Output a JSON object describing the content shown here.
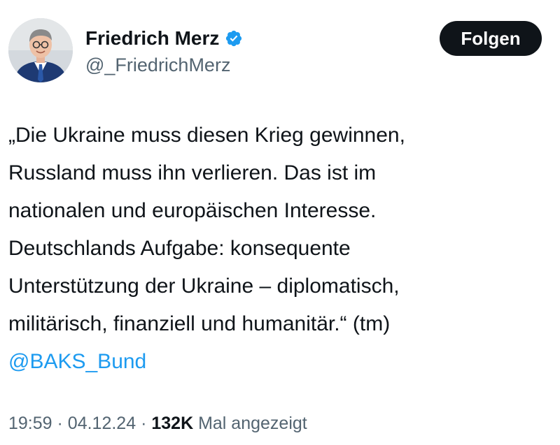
{
  "author": {
    "display_name": "Friedrich Merz",
    "handle": "@_FriedrichMerz",
    "verified_icon": "verified-badge-icon",
    "verified_color": "#1d9bf0"
  },
  "follow_button": {
    "label": "Folgen"
  },
  "tweet": {
    "lines": [
      "„Die Ukraine muss diesen Krieg gewinnen,",
      "Russland muss ihn verlieren. Das ist im",
      "nationalen und europäischen Interesse.",
      "Deutschlands Aufgabe: konsequente",
      "Unterstützung der Ukraine – diplomatisch,",
      "militärisch, finanziell und humanitär.“ (tm)"
    ],
    "mention": "@BAKS_Bund",
    "mention_color": "#1d9bf0"
  },
  "meta": {
    "time": "19:59",
    "separator": "·",
    "date": "04.12.24",
    "views": "132K",
    "views_label": "Mal angezeigt"
  }
}
